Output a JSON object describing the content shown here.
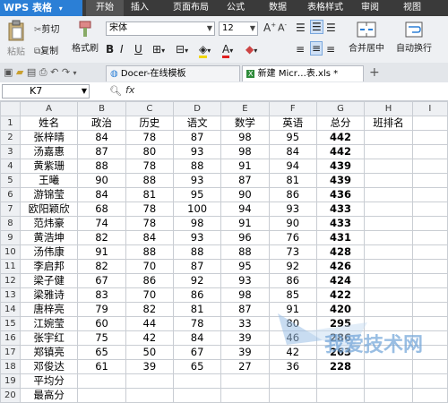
{
  "menubar": {
    "app_label": "WPS 表格",
    "items": [
      "开始",
      "插入",
      "页面布局",
      "公式",
      "数据",
      "表格样式",
      "审阅",
      "视图"
    ]
  },
  "toolbar": {
    "paste": "粘贴",
    "cut": "剪切",
    "copy": "复制",
    "format_painter": "格式刷",
    "font_name": "宋体",
    "font_size": "12",
    "merge_center": "合并居中",
    "auto_wrap": "自动换行",
    "bold": "B",
    "italic": "I",
    "underline": "U",
    "font_color_letter": "A"
  },
  "doc_tabs": [
    {
      "label": "Docer-在线模板"
    },
    {
      "label": "新建 Micr…表.xls *"
    }
  ],
  "formula_bar": {
    "cell_ref": "K7",
    "fx": "fx",
    "zoom_icon_label": "Q"
  },
  "sheet": {
    "col_letters": [
      "A",
      "B",
      "C",
      "D",
      "E",
      "F",
      "G",
      "H",
      "I"
    ],
    "rows": [
      {
        "n": "1",
        "cells": [
          "姓名",
          "政治",
          "历史",
          "语文",
          "数学",
          "英语",
          "总分",
          "班排名"
        ]
      },
      {
        "n": "2",
        "cells": [
          "张梓晴",
          "84",
          "78",
          "87",
          "98",
          "95",
          "442",
          ""
        ]
      },
      {
        "n": "3",
        "cells": [
          "汤嘉惠",
          "87",
          "80",
          "93",
          "98",
          "84",
          "442",
          ""
        ]
      },
      {
        "n": "4",
        "cells": [
          "黄紫珊",
          "88",
          "78",
          "88",
          "91",
          "94",
          "439",
          ""
        ]
      },
      {
        "n": "5",
        "cells": [
          "王曦",
          "90",
          "88",
          "93",
          "87",
          "81",
          "439",
          ""
        ]
      },
      {
        "n": "6",
        "cells": [
          "游锦莹",
          "84",
          "81",
          "95",
          "90",
          "86",
          "436",
          ""
        ]
      },
      {
        "n": "7",
        "cells": [
          "欧阳颖欣",
          "68",
          "78",
          "100",
          "94",
          "93",
          "433",
          ""
        ]
      },
      {
        "n": "8",
        "cells": [
          "范炜豪",
          "74",
          "78",
          "98",
          "91",
          "90",
          "433",
          ""
        ]
      },
      {
        "n": "9",
        "cells": [
          "黄浩坤",
          "82",
          "84",
          "93",
          "96",
          "76",
          "431",
          ""
        ]
      },
      {
        "n": "10",
        "cells": [
          "汤伟康",
          "91",
          "88",
          "88",
          "88",
          "73",
          "428",
          ""
        ]
      },
      {
        "n": "11",
        "cells": [
          "李启邦",
          "82",
          "70",
          "87",
          "95",
          "92",
          "426",
          ""
        ]
      },
      {
        "n": "12",
        "cells": [
          "梁子健",
          "67",
          "86",
          "92",
          "93",
          "86",
          "424",
          ""
        ]
      },
      {
        "n": "13",
        "cells": [
          "梁雅诗",
          "83",
          "70",
          "86",
          "98",
          "85",
          "422",
          ""
        ]
      },
      {
        "n": "14",
        "cells": [
          "唐梓亮",
          "79",
          "82",
          "81",
          "87",
          "91",
          "420",
          ""
        ]
      },
      {
        "n": "15",
        "cells": [
          "江婉莹",
          "60",
          "44",
          "78",
          "33",
          "80",
          "295",
          ""
        ]
      },
      {
        "n": "16",
        "cells": [
          "张宇红",
          "75",
          "42",
          "84",
          "39",
          "46",
          "286",
          ""
        ]
      },
      {
        "n": "17",
        "cells": [
          "郑镇亮",
          "65",
          "50",
          "67",
          "39",
          "42",
          "263",
          ""
        ]
      },
      {
        "n": "18",
        "cells": [
          "邓俊达",
          "61",
          "39",
          "65",
          "27",
          "36",
          "228",
          ""
        ]
      },
      {
        "n": "19",
        "cells": [
          "平均分",
          "",
          "",
          "",
          "",
          "",
          "",
          ""
        ]
      },
      {
        "n": "20",
        "cells": [
          "最高分",
          "",
          "",
          "",
          "",
          "",
          "",
          ""
        ]
      }
    ]
  },
  "watermark": {
    "text": "我爱技术网"
  },
  "colors": {
    "app_blue": "#2b7fd6",
    "menubar": "#3a3a3a",
    "selection": "#1e6ed8"
  }
}
